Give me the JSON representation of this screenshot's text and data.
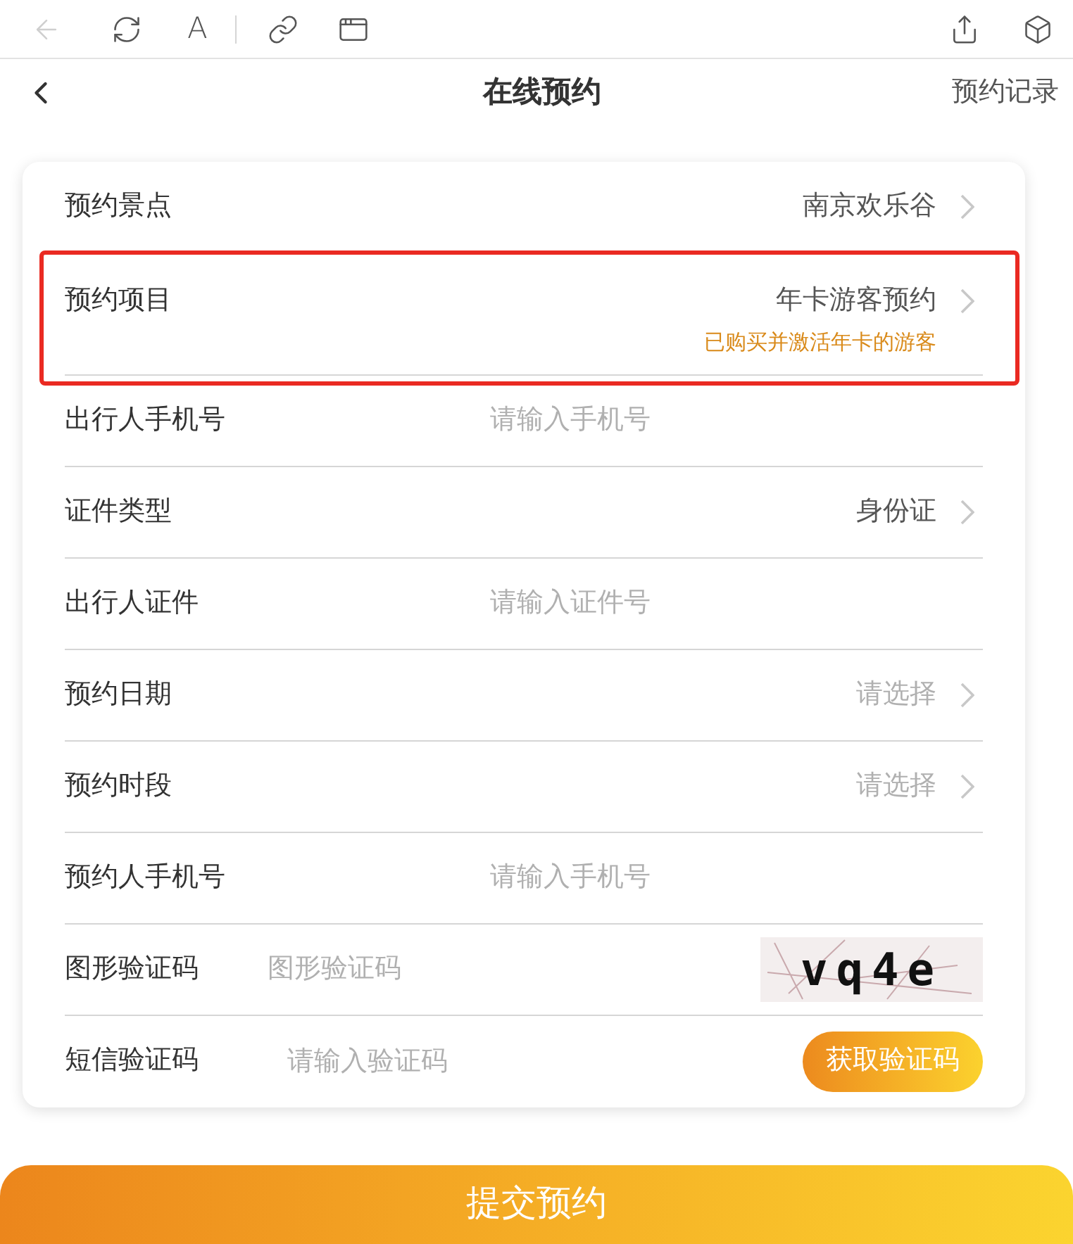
{
  "toolbar": {
    "back_disabled": true,
    "font_label": "A"
  },
  "header": {
    "title": "在线预约",
    "action": "预约记录"
  },
  "rows": [
    {
      "kind": "select",
      "label": "预约景点",
      "value": "南京欢乐谷",
      "highlighted": false
    },
    {
      "kind": "select",
      "label": "预约项目",
      "value": "年卡游客预约",
      "note": "已购买并激活年卡的游客",
      "highlighted": true
    },
    {
      "kind": "input",
      "label": "出行人手机号",
      "placeholder": "请输入手机号",
      "highlighted": false
    },
    {
      "kind": "select",
      "label": "证件类型",
      "value": "身份证",
      "highlighted": false
    },
    {
      "kind": "input",
      "label": "出行人证件",
      "placeholder": "请输入证件号",
      "highlighted": false
    },
    {
      "kind": "select",
      "label": "预约日期",
      "placeholder": "请选择",
      "highlighted": false
    },
    {
      "kind": "select",
      "label": "预约时段",
      "placeholder": "请选择",
      "highlighted": false
    },
    {
      "kind": "input",
      "label": "预约人手机号",
      "placeholder": "请输入手机号",
      "highlighted": false
    },
    {
      "kind": "captcha",
      "label": "图形验证码",
      "placeholder": "图形验证码",
      "captcha": "vq4e",
      "highlighted": false
    },
    {
      "kind": "sms",
      "label": "短信验证码",
      "placeholder": "请输入验证码",
      "button": "获取验证码",
      "highlighted": false
    }
  ],
  "submit": "提交预约"
}
